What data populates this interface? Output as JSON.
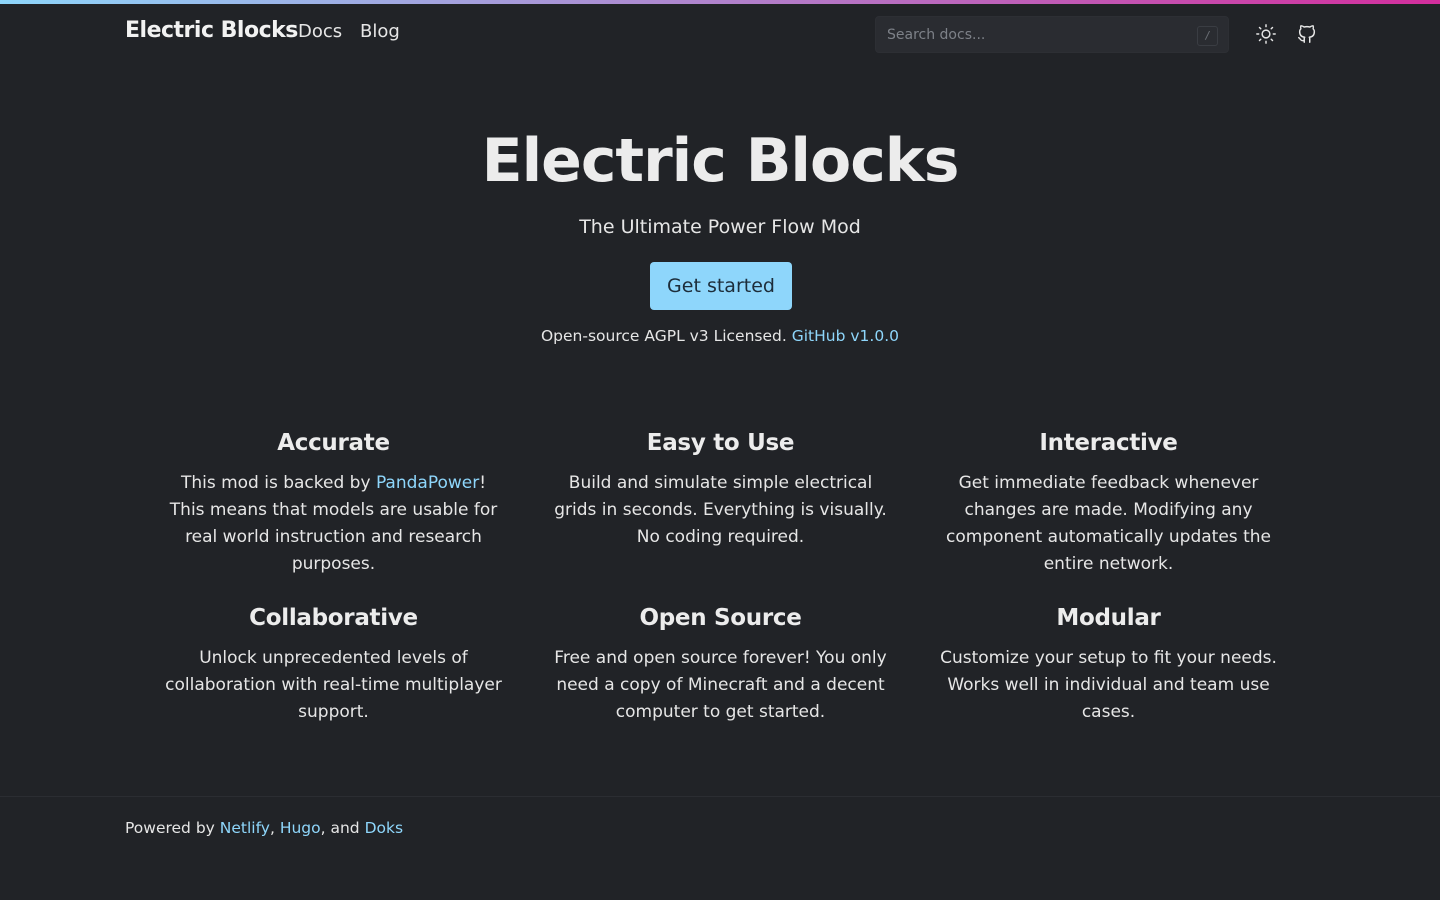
{
  "colors": {
    "background": "#212327",
    "accent": "#8ed6fb",
    "gradient_end": "#d32e9d"
  },
  "header": {
    "brand": "Electric Blocks",
    "nav": [
      "Docs",
      "Blog"
    ],
    "search_placeholder": "Search docs...",
    "search_shortcut": "/",
    "icons": [
      "sun-icon",
      "github-icon"
    ]
  },
  "hero": {
    "title": "Electric Blocks",
    "subtitle": "The Ultimate Power Flow Mod",
    "cta": "Get started",
    "license_text": "Open-source AGPL v3 Licensed.",
    "license_link": "GitHub v1.0.0"
  },
  "features": [
    {
      "title": "Accurate",
      "text_before": "This mod is backed by ",
      "link": "PandaPower",
      "text_after": "! This means that models are usable for real world instruction and research purposes."
    },
    {
      "title": "Easy to Use",
      "text": "Build and simulate simple electrical grids in seconds. Everything is visually. No coding required."
    },
    {
      "title": "Interactive",
      "text": "Get immediate feedback whenever changes are made. Modifying any component automatically updates the entire network."
    },
    {
      "title": "Collaborative",
      "text": "Unlock unprecedented levels of collaboration with real-time multiplayer support."
    },
    {
      "title": "Open Source",
      "text": "Free and open source forever! You only need a copy of Minecraft and a decent computer to get started."
    },
    {
      "title": "Modular",
      "text": "Customize your setup to fit your needs. Works well in individual and team use cases."
    }
  ],
  "footer": {
    "prefix": "Powered by ",
    "links": [
      "Netlify",
      "Hugo",
      "Doks"
    ],
    "sep1": ", ",
    "sep2": ", and "
  }
}
